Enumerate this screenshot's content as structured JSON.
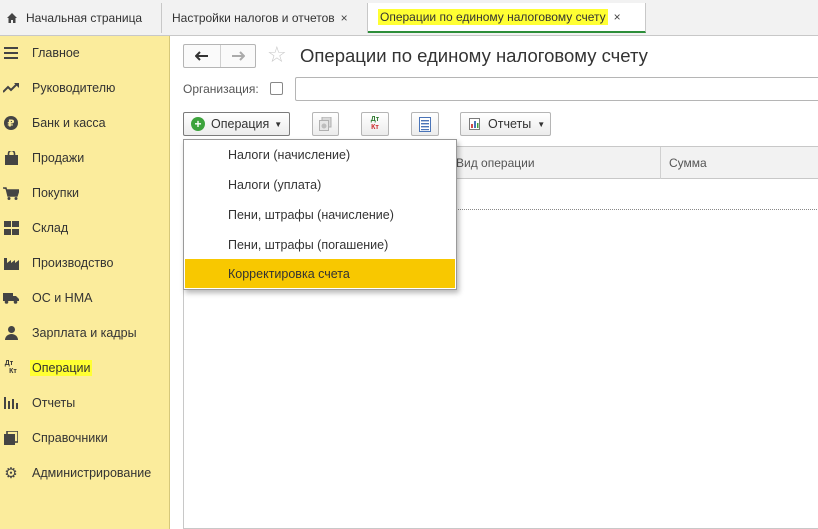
{
  "tabs": {
    "home": "Начальная страница",
    "tax_settings": "Настройки налогов и отчетов",
    "active": "Операции по единому налоговому счету",
    "close_glyph": "×"
  },
  "sidebar": {
    "items": [
      {
        "label": "Главное",
        "icon": "menu-icon"
      },
      {
        "label": "Руководителю",
        "icon": "trend-icon"
      },
      {
        "label": "Банк и касса",
        "icon": "ruble-icon"
      },
      {
        "label": "Продажи",
        "icon": "bag-icon"
      },
      {
        "label": "Покупки",
        "icon": "cart-icon"
      },
      {
        "label": "Склад",
        "icon": "warehouse-icon"
      },
      {
        "label": "Производство",
        "icon": "factory-icon"
      },
      {
        "label": "ОС и НМА",
        "icon": "truck-icon"
      },
      {
        "label": "Зарплата и кадры",
        "icon": "person-icon"
      },
      {
        "label": "Операции",
        "icon": "dt-kt-icon",
        "dt": "Дт",
        "kt": "Кт"
      },
      {
        "label": "Отчеты",
        "icon": "bar-chart-icon"
      },
      {
        "label": "Справочники",
        "icon": "books-icon"
      },
      {
        "label": "Администрирование",
        "icon": "gear-icon"
      }
    ]
  },
  "header": {
    "title": "Операции по единому налоговому счету",
    "back": "🡐",
    "forward": "🡒",
    "star": "☆"
  },
  "filter": {
    "org_label": "Организация:"
  },
  "toolbar": {
    "operation_label": "Операция",
    "reports_label": "Отчеты",
    "dt": "Дт",
    "kt": "Кт"
  },
  "table": {
    "columns": [
      "",
      "Вид операции",
      "Сумма"
    ]
  },
  "operation_menu": {
    "items": [
      "Налоги (начисление)",
      "Налоги (уплата)",
      "Пени, штрафы (начисление)",
      "Пени, штрафы (погашение)",
      "Корректировка счета"
    ],
    "selected_index": 4
  },
  "colors": {
    "sidebar_bg": "#fbec9c",
    "highlight": "#ffff33",
    "menu_selected": "#f8c800",
    "active_tab_underline": "#2d8e3a",
    "add_green": "#3ca33c"
  }
}
